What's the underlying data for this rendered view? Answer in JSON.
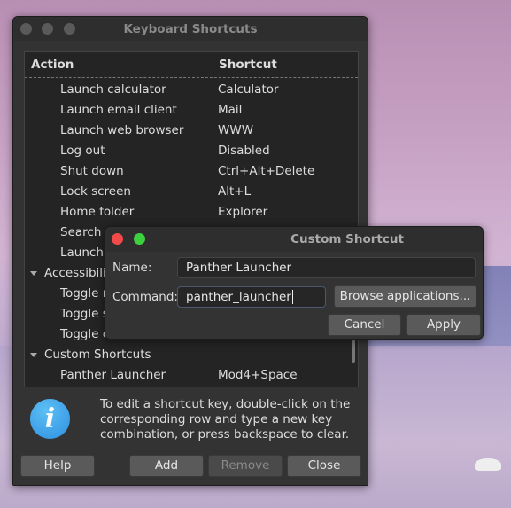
{
  "main_window": {
    "title": "Keyboard Shortcuts",
    "columns": {
      "action": "Action",
      "shortcut": "Shortcut"
    },
    "rows": [
      {
        "action": "Launch calculator",
        "shortcut": "Calculator"
      },
      {
        "action": "Launch email client",
        "shortcut": "Mail"
      },
      {
        "action": "Launch web browser",
        "shortcut": "WWW"
      },
      {
        "action": "Log out",
        "shortcut": "Disabled"
      },
      {
        "action": "Shut down",
        "shortcut": "Ctrl+Alt+Delete"
      },
      {
        "action": "Lock screen",
        "shortcut": "Alt+L"
      },
      {
        "action": "Home folder",
        "shortcut": "Explorer"
      },
      {
        "action": "Search",
        "shortcut": ""
      },
      {
        "action": "Launch s",
        "shortcut": ""
      },
      {
        "action": "Accessibili",
        "shortcut": "",
        "group": true
      },
      {
        "action": "Toggle r",
        "shortcut": ""
      },
      {
        "action": "Toggle s",
        "shortcut": ""
      },
      {
        "action": "Toggle c",
        "shortcut": ""
      },
      {
        "action": "Custom Shortcuts",
        "shortcut": "",
        "group": true
      },
      {
        "action": "Panther Launcher",
        "shortcut": "Mod4+Space"
      }
    ],
    "info_text": [
      "To edit a shortcut key, double-click on the",
      "corresponding row and type a new key",
      "combination, or press backspace to clear."
    ],
    "buttons": {
      "help": "Help",
      "add": "Add",
      "remove": "Remove",
      "close": "Close"
    },
    "info_icon": "info-icon"
  },
  "dialog": {
    "title": "Custom Shortcut",
    "name_label": "Name:",
    "name_value": "Panther Launcher",
    "command_label": "Command:",
    "command_value": "panther_launcher",
    "browse": "Browse applications...",
    "cancel": "Cancel",
    "apply": "Apply",
    "close_color": "#f04a4a",
    "maximize_color": "#3ed13e"
  }
}
